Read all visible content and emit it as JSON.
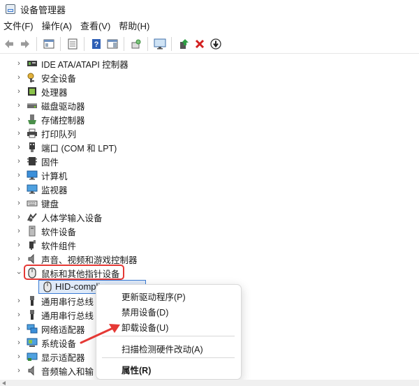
{
  "window": {
    "title": "设备管理器"
  },
  "menu": [
    "文件(F)",
    "操作(A)",
    "查看(V)",
    "帮助(H)"
  ],
  "toolbar": {
    "icons": [
      "back-arrow-icon",
      "forward-arrow-icon",
      "show-hide-console-tree-icon",
      "properties-icon",
      "help-icon",
      "action-pane-icon",
      "scan-hardware-icon",
      "monitor-icon",
      "update-driver-icon",
      "uninstall-x-icon",
      "disable-device-icon"
    ]
  },
  "tree": {
    "items": [
      {
        "label": "IDE ATA/ATAPI 控制器",
        "icon": "ide-controller-icon"
      },
      {
        "label": "安全设备",
        "icon": "security-key-icon"
      },
      {
        "label": "处理器",
        "icon": "processor-icon"
      },
      {
        "label": "磁盘驱动器",
        "icon": "disk-drive-icon"
      },
      {
        "label": "存储控制器",
        "icon": "storage-controller-icon"
      },
      {
        "label": "打印队列",
        "icon": "printer-icon"
      },
      {
        "label": "端口 (COM 和 LPT)",
        "icon": "port-icon"
      },
      {
        "label": "固件",
        "icon": "firmware-icon"
      },
      {
        "label": "计算机",
        "icon": "computer-icon"
      },
      {
        "label": "监视器",
        "icon": "monitor-icon"
      },
      {
        "label": "键盘",
        "icon": "keyboard-icon"
      },
      {
        "label": "人体学输入设备",
        "icon": "hid-icon"
      },
      {
        "label": "软件设备",
        "icon": "software-device-icon"
      },
      {
        "label": "软件组件",
        "icon": "software-component-icon"
      },
      {
        "label": "声音、视频和游戏控制器",
        "icon": "speaker-icon"
      },
      {
        "label": "鼠标和其他指针设备",
        "icon": "mouse-icon"
      }
    ],
    "selected_child": {
      "label": "HID-compli",
      "icon": "mouse-icon"
    },
    "below_items": [
      {
        "label": "通用串行总线",
        "icon": "usb-icon"
      },
      {
        "label": "通用串行总线",
        "icon": "usb-icon"
      },
      {
        "label": "网络适配器",
        "icon": "network-adapter-icon"
      },
      {
        "label": "系统设备",
        "icon": "system-device-icon"
      },
      {
        "label": "显示适配器",
        "icon": "display-adapter-icon"
      },
      {
        "label": "音频输入和输",
        "icon": "audio-io-icon"
      }
    ]
  },
  "context_menu": {
    "items": [
      "更新驱动程序(P)",
      "禁用设备(D)",
      "卸载设备(U)",
      "扫描检测硬件改动(A)",
      "属性(R)"
    ]
  },
  "colors": {
    "highlight_red": "#e53935",
    "selection_blue": "#3a7bd5",
    "arrow_red": "#e53935"
  }
}
